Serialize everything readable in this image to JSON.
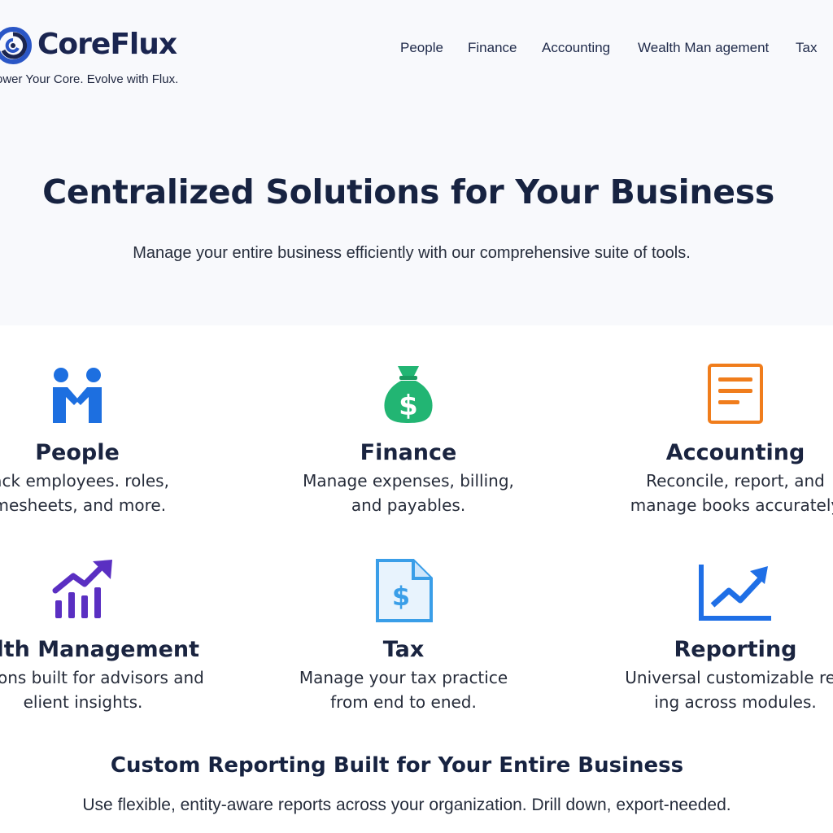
{
  "header": {
    "brand": "CoreFlux",
    "tagline": "ower Your Core. Evolve with Flux.",
    "logo_icon": "swirl-logo-icon",
    "nav": [
      "People",
      "Finance",
      "Accounting",
      "Wealth Man agement",
      "Tax"
    ]
  },
  "hero": {
    "title": "Centralized Solutions for Your Business",
    "subtitle": "Manage your entire business efficiently with our comprehensive suite of tools."
  },
  "features": [
    {
      "icon": "handshake-people-icon",
      "title": "People",
      "desc": "rack employees. roles, imesheets, and more."
    },
    {
      "icon": "money-bag-icon",
      "title": "Finance",
      "desc": "Manage expenses, billing, and payables."
    },
    {
      "icon": "document-list-icon",
      "title": "Accounting",
      "desc": "Reconcile, report, and manage books accurately"
    },
    {
      "icon": "growth-chart-icon",
      "title": "ealth Management",
      "desc": "olutions built for advisors and elient insights."
    },
    {
      "icon": "tax-document-icon",
      "title": "Tax",
      "desc": "Manage your tax practice from end to ened."
    },
    {
      "icon": "trend-line-icon",
      "title": "Reporting",
      "desc": "Universal customizable rep ing across modules."
    }
  ],
  "section": {
    "title": "Custom Reporting Built for Your Entire Business",
    "subtitle": "Use flexible, entity-aware reports across your organization. Drill down, export-needed."
  },
  "colors": {
    "brand_navy": "#1a2550",
    "logo_blue": "#2a56c6",
    "people_blue": "#1d6fe0",
    "finance_green": "#22b573",
    "accounting_orange": "#f07d1c",
    "wealth_purple": "#5a2fc2",
    "tax_lightblue": "#3a9ee8",
    "reporting_blue": "#1f6fe6"
  }
}
